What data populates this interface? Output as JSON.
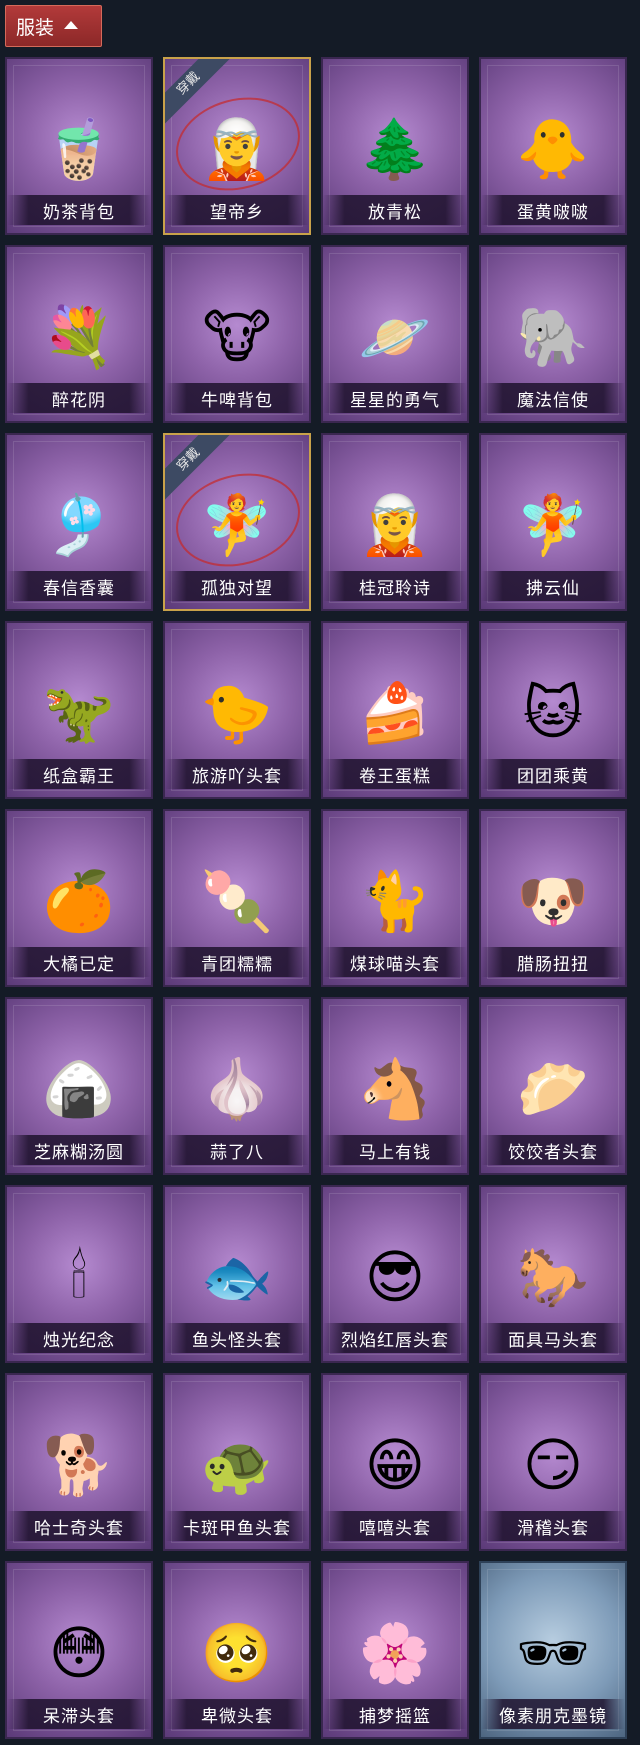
{
  "header": {
    "label": "服装",
    "icon": "chevron-up-icon"
  },
  "badge_text": "穿戴",
  "items": [
    {
      "name": "奶茶背包",
      "icon": "milk-tea-backpack-icon",
      "glyph": "🧋",
      "equipped": false,
      "color": "#f3d6b0"
    },
    {
      "name": "望帝乡",
      "icon": "character-pendant-icon",
      "glyph": "🧝",
      "equipped": true,
      "color": "#3b3550"
    },
    {
      "name": "放青松",
      "icon": "pine-bonsai-icon",
      "glyph": "🌲",
      "equipped": false,
      "color": "#5aa24a"
    },
    {
      "name": "蛋黄啵啵",
      "icon": "chick-icon",
      "glyph": "🐥",
      "equipped": false,
      "color": "#f7e27a"
    },
    {
      "name": "醉花阴",
      "icon": "flower-wreath-icon",
      "glyph": "💐",
      "equipped": false,
      "color": "#6aa0c8"
    },
    {
      "name": "牛啤背包",
      "icon": "cow-beer-barrel-icon",
      "glyph": "🐮",
      "equipped": false,
      "color": "#b07040"
    },
    {
      "name": "星星的勇气",
      "icon": "star-prince-icon",
      "glyph": "🪐",
      "equipped": false,
      "color": "#e8c86a"
    },
    {
      "name": "魔法信使",
      "icon": "elephant-icon",
      "glyph": "🐘",
      "equipped": false,
      "color": "#c8d8f0"
    },
    {
      "name": "春信香囊",
      "icon": "sachet-icon",
      "glyph": "🎐",
      "equipped": false,
      "color": "#c8e8a0"
    },
    {
      "name": "孤独对望",
      "icon": "silver-character-icon",
      "glyph": "🧚",
      "equipped": true,
      "color": "#d0d8f0"
    },
    {
      "name": "桂冠聆诗",
      "icon": "laurel-character-icon",
      "glyph": "🧝",
      "equipped": false,
      "color": "#c8e0a0"
    },
    {
      "name": "拂云仙",
      "icon": "cloud-fairy-icon",
      "glyph": "🧚",
      "equipped": false,
      "color": "#f0c8d8"
    },
    {
      "name": "纸盒霸王",
      "icon": "cardboard-dino-icon",
      "glyph": "🦖",
      "equipped": false,
      "color": "#5ab0c0"
    },
    {
      "name": "旅游吖头套",
      "icon": "duck-hat-icon",
      "glyph": "🐤",
      "equipped": false,
      "color": "#ffffff"
    },
    {
      "name": "卷王蛋糕",
      "icon": "roll-cake-icon",
      "glyph": "🍰",
      "equipped": false,
      "color": "#f0c070"
    },
    {
      "name": "团团乘黄",
      "icon": "horned-cat-icon",
      "glyph": "🐱",
      "equipped": false,
      "color": "#f5dcb0"
    },
    {
      "name": "大橘已定",
      "icon": "orange-slice-icon",
      "glyph": "🍊",
      "equipped": false,
      "color": "#f5a030"
    },
    {
      "name": "青团糯糯",
      "icon": "green-dumpling-icon",
      "glyph": "🍡",
      "equipped": false,
      "color": "#80d060"
    },
    {
      "name": "煤球喵头套",
      "icon": "black-cat-icon",
      "glyph": "🐈",
      "equipped": false,
      "color": "#506080"
    },
    {
      "name": "腊肠扭扭",
      "icon": "dachshund-icon",
      "glyph": "🐶",
      "equipped": false,
      "color": "#a86a40"
    },
    {
      "name": "芝麻糊汤圆",
      "icon": "rice-ball-icon",
      "glyph": "🍙",
      "equipped": false,
      "color": "#f4f4f8"
    },
    {
      "name": "蒜了八",
      "icon": "garlic-icon",
      "glyph": "🧄",
      "equipped": false,
      "color": "#f0ead8"
    },
    {
      "name": "马上有钱",
      "icon": "red-horse-icon",
      "glyph": "🐴",
      "equipped": false,
      "color": "#d84050"
    },
    {
      "name": "饺饺者头套",
      "icon": "dumpling-cloud-icon",
      "glyph": "🥟",
      "equipped": false,
      "color": "#f4f4f4"
    },
    {
      "name": "烛光纪念",
      "icon": "candle-icon",
      "glyph": "🕯",
      "equipped": false,
      "color": "#f8e8d8"
    },
    {
      "name": "鱼头怪头套",
      "icon": "fish-head-icon",
      "glyph": "🐟",
      "equipped": false,
      "color": "#6aa040"
    },
    {
      "name": "烈焰红唇头套",
      "icon": "pikachu-sunglasses-icon",
      "glyph": "😎",
      "equipped": false,
      "color": "#f0c020"
    },
    {
      "name": "面具马头套",
      "icon": "horse-mask-icon",
      "glyph": "🐎",
      "equipped": false,
      "color": "#603828"
    },
    {
      "name": "哈士奇头套",
      "icon": "husky-icon",
      "glyph": "🐕",
      "equipped": false,
      "color": "#303030"
    },
    {
      "name": "卡斑甲鱼头套",
      "icon": "turtle-head-icon",
      "glyph": "🐢",
      "equipped": false,
      "color": "#303840"
    },
    {
      "name": "嘻嘻头套",
      "icon": "grin-emoji-icon",
      "glyph": "😁",
      "equipped": false,
      "color": "#f8c020"
    },
    {
      "name": "滑稽头套",
      "icon": "smirk-emoji-icon",
      "glyph": "😏",
      "equipped": false,
      "color": "#f8c020"
    },
    {
      "name": "呆滞头套",
      "icon": "flushed-emoji-icon",
      "glyph": "😳",
      "equipped": false,
      "color": "#f8c020"
    },
    {
      "name": "卑微头套",
      "icon": "pleading-emoji-icon",
      "glyph": "🥺",
      "equipped": false,
      "color": "#f8c020"
    },
    {
      "name": "捕梦摇篮",
      "icon": "mannequin-head-icon",
      "glyph": "🌸",
      "equipped": false,
      "color": "#f4e8e8"
    },
    {
      "name": "像素朋克墨镜",
      "icon": "pixel-sunglasses-icon",
      "glyph": "🕶",
      "equipped": false,
      "color": "#202020",
      "blue": true
    }
  ]
}
